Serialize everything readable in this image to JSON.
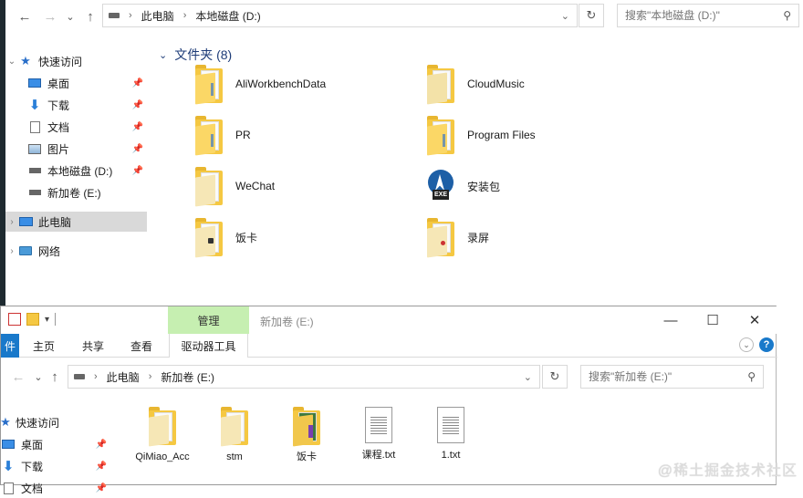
{
  "top_window": {
    "nav": {
      "back": "←",
      "forward": "→",
      "dropdown": "⌄",
      "up": "↑"
    },
    "breadcrumb": [
      "此电脑",
      "本地磁盘 (D:)"
    ],
    "refresh": "↻",
    "search_placeholder": "搜索\"本地磁盘 (D:)\"",
    "sidebar": [
      {
        "label": "快速访问",
        "icon": "star-icon",
        "pinned": false,
        "chevron": "⌄"
      },
      {
        "label": "桌面",
        "icon": "desktop-icon",
        "pinned": true
      },
      {
        "label": "下载",
        "icon": "download-icon",
        "pinned": true
      },
      {
        "label": "文档",
        "icon": "document-icon",
        "pinned": true
      },
      {
        "label": "图片",
        "icon": "picture-icon",
        "pinned": true
      },
      {
        "label": "本地磁盘 (D:)",
        "icon": "drive-icon",
        "pinned": true
      },
      {
        "label": "新加卷 (E:)",
        "icon": "drive-icon",
        "pinned": false
      },
      {
        "label": "此电脑",
        "icon": "computer-icon",
        "pinned": false,
        "chevron": "›",
        "selected": true
      },
      {
        "label": "网络",
        "icon": "network-icon",
        "pinned": false,
        "chevron": "›"
      }
    ],
    "group_title": "文件夹 (8)",
    "folders": [
      {
        "name": "AliWorkbenchData",
        "kind": "folder"
      },
      {
        "name": "CloudMusic",
        "kind": "folder"
      },
      {
        "name": "PR",
        "kind": "folder"
      },
      {
        "name": "Program Files",
        "kind": "folder"
      },
      {
        "name": "WeChat",
        "kind": "folder"
      },
      {
        "name": "安装包",
        "kind": "exe"
      },
      {
        "name": "饭卡",
        "kind": "folder"
      },
      {
        "name": "录屏",
        "kind": "folder"
      }
    ]
  },
  "bottom_window": {
    "title": "新加卷 (E:)",
    "context_group": "管理",
    "tabs": {
      "file": "件",
      "home": "主页",
      "share": "共享",
      "view": "查看",
      "drive_tools": "驱动器工具"
    },
    "window_buttons": {
      "minimize": "—",
      "maximize": "☐",
      "close": "✕"
    },
    "breadcrumb": [
      "此电脑",
      "新加卷 (E:)"
    ],
    "refresh": "↻",
    "search_placeholder": "搜索\"新加卷 (E:)\"",
    "sidebar": [
      {
        "label": "快速访问",
        "icon": "star-icon"
      },
      {
        "label": "桌面",
        "icon": "desktop-icon",
        "pinned": true
      },
      {
        "label": "下载",
        "icon": "download-icon",
        "pinned": true
      },
      {
        "label": "文档",
        "icon": "document-icon",
        "pinned": true
      }
    ],
    "items": [
      {
        "name": "QiMiao_Acc",
        "kind": "folder"
      },
      {
        "name": "stm",
        "kind": "folder"
      },
      {
        "name": "饭卡",
        "kind": "archive"
      },
      {
        "name": "课程.txt",
        "kind": "text"
      },
      {
        "name": "1.txt",
        "kind": "text"
      }
    ]
  },
  "watermark": "@稀土掘金技术社区",
  "colors": {
    "accent": "#1979ca",
    "context_group": "#c6efb1",
    "folder": "#f5c842",
    "group_title": "#1e3c78",
    "selected": "#d9d9d9"
  }
}
